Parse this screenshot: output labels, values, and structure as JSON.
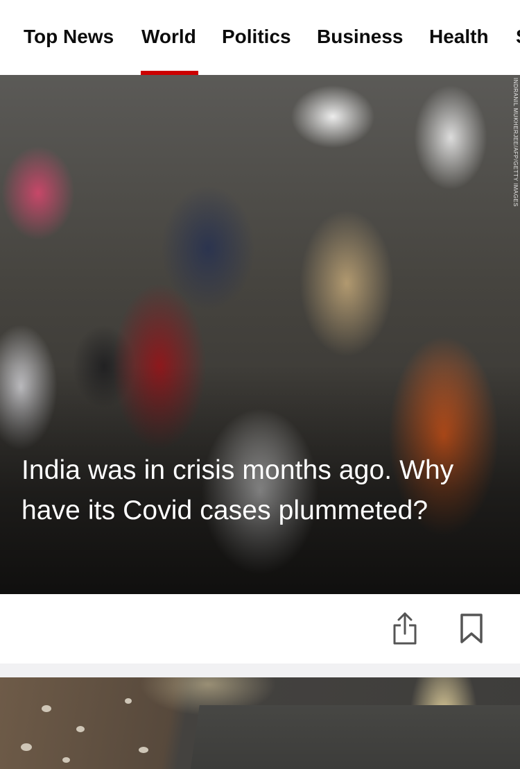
{
  "nav": {
    "tabs": [
      {
        "label": "Top News"
      },
      {
        "label": "World"
      },
      {
        "label": "Politics"
      },
      {
        "label": "Business"
      },
      {
        "label": "Health"
      },
      {
        "label": "S"
      }
    ],
    "active_tab": "World",
    "accent_color": "#cc0000"
  },
  "hero": {
    "headline": "India was in crisis months ago. Why have its Covid cases plummeted?",
    "photo_credit": "INDRANIL MUKHERJEE/AFP/GETTY IMAGES"
  },
  "actions": {
    "share_icon": "share-icon",
    "bookmark_icon": "bookmark-icon"
  }
}
